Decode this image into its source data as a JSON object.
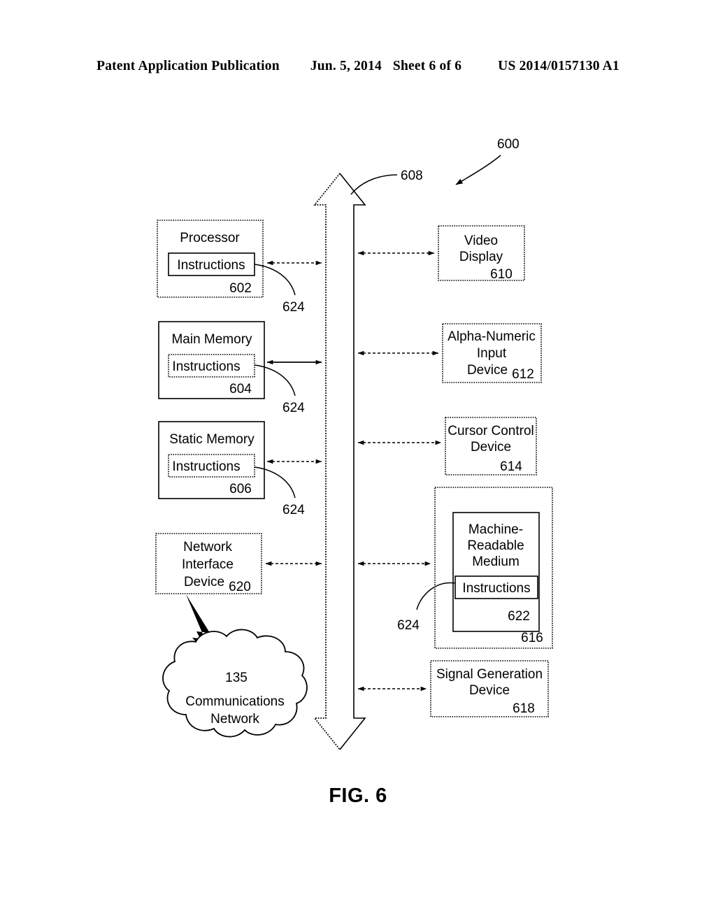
{
  "header": {
    "publication": "Patent Application Publication",
    "date": "Jun. 5, 2014",
    "sheet": "Sheet 6 of 6",
    "patent_number": "US 2014/0157130 A1"
  },
  "figure": {
    "caption": "FIG. 6",
    "system_ref": "600",
    "bus": {
      "ref": "608"
    },
    "left_column": [
      {
        "id": "processor",
        "title": "Processor",
        "inner_label": "Instructions",
        "ref": "602",
        "inner_ref": "624",
        "outer_border": "dotted",
        "inner_border": "solid",
        "connector": "dashed"
      },
      {
        "id": "main-memory",
        "title": "Main Memory",
        "inner_label": "Instructions",
        "ref": "604",
        "inner_ref": "624",
        "outer_border": "solid",
        "inner_border": "dotted",
        "connector": "solid"
      },
      {
        "id": "static-memory",
        "title": "Static Memory",
        "inner_label": "Instructions",
        "ref": "606",
        "inner_ref": "624",
        "outer_border": "solid",
        "inner_border": "dotted",
        "connector": "dashed"
      },
      {
        "id": "network-interface-device",
        "title_line1": "Network",
        "title_line2": "Interface",
        "title_line3": "Device",
        "ref": "620",
        "outer_border": "dotted",
        "connector": "dashed"
      }
    ],
    "cloud": {
      "ref": "135",
      "label_line1": "Communications",
      "label_line2": "Network"
    },
    "right_column": [
      {
        "id": "video-display",
        "title_line1": "Video",
        "title_line2": "Display",
        "ref": "610",
        "outer_border": "dotted",
        "connector": "dashed"
      },
      {
        "id": "alpha-numeric-input-device",
        "title_line1": "Alpha-Numeric",
        "title_line2": "Input",
        "title_line3": "Device",
        "ref": "612",
        "outer_border": "dotted",
        "connector": "dashed"
      },
      {
        "id": "cursor-control-device",
        "title_line1": "Cursor Control",
        "title_line2": "Device",
        "ref": "614",
        "outer_border": "dotted",
        "connector": "dashed"
      },
      {
        "id": "machine-readable-medium",
        "outer_ref": "616",
        "title_line1": "Machine-",
        "title_line2": "Readable",
        "title_line3": "Medium",
        "inner_label": "Instructions",
        "ref": "622",
        "inner_ref": "624",
        "outer_border": "dotted",
        "connector": "dashed"
      },
      {
        "id": "signal-generation-device",
        "title_line1": "Signal Generation",
        "title_line2": "Device",
        "ref": "618",
        "outer_border": "dotted",
        "connector": "dashed"
      }
    ]
  },
  "colors": {
    "ink": "#000000",
    "paper": "#ffffff"
  }
}
